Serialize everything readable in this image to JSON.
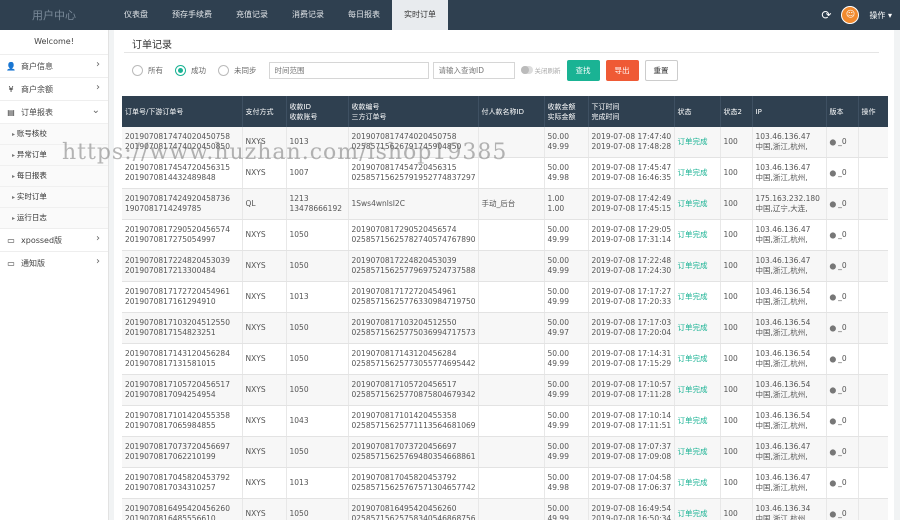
{
  "app": {
    "brand": "用户中心"
  },
  "nav": {
    "tabs": [
      {
        "label": "仪表盘"
      },
      {
        "label": "预存手续费"
      },
      {
        "label": "充值记录"
      },
      {
        "label": "消费记录"
      },
      {
        "label": "每日报表"
      },
      {
        "label": "实时订单"
      }
    ],
    "active_index": 5
  },
  "user": {
    "op_label": "操作 ▾"
  },
  "sidebar": {
    "welcome": "Welcome!",
    "items": [
      {
        "label": "商户信息",
        "icon": "user-icon"
      },
      {
        "label": "商户余额",
        "icon": "yen-icon"
      },
      {
        "label": "订单报表",
        "icon": "doc-icon"
      },
      {
        "label": "xpossed版",
        "icon": "monitor-icon"
      },
      {
        "label": "通知版",
        "icon": "monitor-icon"
      }
    ],
    "sub_items": [
      {
        "label": "账号核校"
      },
      {
        "label": "异常订单"
      },
      {
        "label": "每日报表"
      },
      {
        "label": "实时订单"
      },
      {
        "label": "运行日志"
      }
    ]
  },
  "panel": {
    "title": "订单记录",
    "radios": [
      {
        "label": "所有"
      },
      {
        "label": "成功"
      },
      {
        "label": "未同步"
      }
    ],
    "radio_selected": 1,
    "time_placeholder": "时间范围",
    "query_placeholder": "请输入查询ID",
    "toggle_label": "关闭刷新",
    "btn_find": "查找",
    "btn_export": "导出",
    "btn_reset": "重置"
  },
  "table": {
    "headers": [
      [
        "订单号/下游订单号"
      ],
      [
        "支付方式"
      ],
      [
        "收款ID",
        "收款账号"
      ],
      [
        "收款编号",
        "三方订单号"
      ],
      [
        "付人款名称ID"
      ],
      [
        "收款金额",
        "实际金额"
      ],
      [
        "下订时间",
        "完成时间"
      ],
      [
        "状态"
      ],
      [
        "状态2"
      ],
      [
        "IP"
      ],
      [
        "版本"
      ],
      [
        "操作"
      ]
    ],
    "rows": [
      {
        "order": "2019070817474020450758",
        "down": "2019070817474020450850",
        "pay": "NXYS",
        "rid": "1013",
        "racct": "",
        "rno": "2019070817474020450758",
        "tno": "02585715626791745904850",
        "payer": "",
        "amt": "50.00",
        "real": "49.99",
        "t1": "2019-07-08 17:47:40",
        "t2": "2019-07-08 17:48:28",
        "status": "订单完成",
        "s2": "100",
        "ip": "103.46.136.47",
        "loc": "中国,浙江,杭州,",
        "ver": "_0"
      },
      {
        "order": "2019070817454720456315",
        "down": "2019070814432489848",
        "pay": "NXYS",
        "rid": "1007",
        "racct": "",
        "rno": "2019070817454720456315",
        "tno": "02585715625791952774837297",
        "payer": "",
        "amt": "50.00",
        "real": "49.98",
        "t1": "2019-07-08 17:45:47",
        "t2": "2019-07-08 16:46:35",
        "status": "订单完成",
        "s2": "100",
        "ip": "103.46.136.47",
        "loc": "中国,浙江,杭州,",
        "ver": "_0"
      },
      {
        "order": "2019070817424920458736",
        "down": "1907081714249785",
        "pay": "QL",
        "rid": "1213",
        "racct": "13478666192",
        "rno": "1Sws4wnlsI2C",
        "tno": "",
        "payer": "手动_后台",
        "amt": "1.00",
        "real": "1.00",
        "t1": "2019-07-08 17:42:49",
        "t2": "2019-07-08 17:45:15",
        "status": "订单完成",
        "s2": "100",
        "ip": "175.163.232.180",
        "loc": "中国,辽宁,大连,",
        "ver": "_0"
      },
      {
        "order": "2019070817290520456574",
        "down": "2019070817275054997",
        "pay": "NXYS",
        "rid": "1050",
        "racct": "",
        "rno": "2019070817290520456574",
        "tno": "02585715625782740574767890",
        "payer": "",
        "amt": "50.00",
        "real": "49.99",
        "t1": "2019-07-08 17:29:05",
        "t2": "2019-07-08 17:31:14",
        "status": "订单完成",
        "s2": "100",
        "ip": "103.46.136.47",
        "loc": "中国,浙江,杭州,",
        "ver": "_0"
      },
      {
        "order": "2019070817224820453039",
        "down": "2019070817213300484",
        "pay": "NXYS",
        "rid": "1050",
        "racct": "",
        "rno": "2019070817224820453039",
        "tno": "02585715625779697524737588",
        "payer": "",
        "amt": "50.00",
        "real": "49.99",
        "t1": "2019-07-08 17:22:48",
        "t2": "2019-07-08 17:24:30",
        "status": "订单完成",
        "s2": "100",
        "ip": "103.46.136.47",
        "loc": "中国,浙江,杭州,",
        "ver": "_0"
      },
      {
        "order": "2019070817172720454961",
        "down": "2019070817161294910",
        "pay": "NXYS",
        "rid": "1013",
        "racct": "",
        "rno": "2019070817172720454961",
        "tno": "02585715625776330984719750",
        "payer": "",
        "amt": "50.00",
        "real": "49.99",
        "t1": "2019-07-08 17:17:27",
        "t2": "2019-07-08 17:20:33",
        "status": "订单完成",
        "s2": "100",
        "ip": "103.46.136.54",
        "loc": "中国,浙江,杭州,",
        "ver": "_0"
      },
      {
        "order": "2019070817103204512550",
        "down": "2019070817154823251",
        "pay": "NXYS",
        "rid": "1050",
        "racct": "",
        "rno": "2019070817103204512550",
        "tno": "02585715625775036994717573",
        "payer": "",
        "amt": "50.00",
        "real": "49.97",
        "t1": "2019-07-08 17:17:03",
        "t2": "2019-07-08 17:20:04",
        "status": "订单完成",
        "s2": "100",
        "ip": "103.46.136.54",
        "loc": "中国,浙江,杭州,",
        "ver": "_0"
      },
      {
        "order": "2019070817143120456284",
        "down": "2019070817131581015",
        "pay": "NXYS",
        "rid": "1050",
        "racct": "",
        "rno": "2019070817143120456284",
        "tno": "02585715625773055774695442",
        "payer": "",
        "amt": "50.00",
        "real": "49.99",
        "t1": "2019-07-08 17:14:31",
        "t2": "2019-07-08 17:15:29",
        "status": "订单完成",
        "s2": "100",
        "ip": "103.46.136.54",
        "loc": "中国,浙江,杭州,",
        "ver": "_0"
      },
      {
        "order": "2019070817105720456517",
        "down": "2019070817094254954",
        "pay": "NXYS",
        "rid": "1050",
        "racct": "",
        "rno": "2019070817105720456517",
        "tno": "02585715625770875804679342",
        "payer": "",
        "amt": "50.00",
        "real": "49.99",
        "t1": "2019-07-08 17:10:57",
        "t2": "2019-07-08 17:11:28",
        "status": "订单完成",
        "s2": "100",
        "ip": "103.46.136.54",
        "loc": "中国,浙江,杭州,",
        "ver": "_0"
      },
      {
        "order": "2019070817101420455358",
        "down": "2019070817065984855",
        "pay": "NXYS",
        "rid": "1043",
        "racct": "",
        "rno": "2019070817101420455358",
        "tno": "02585715625771113564681069",
        "payer": "",
        "amt": "50.00",
        "real": "49.99",
        "t1": "2019-07-08 17:10:14",
        "t2": "2019-07-08 17:11:51",
        "status": "订单完成",
        "s2": "100",
        "ip": "103.46.136.54",
        "loc": "中国,浙江,杭州,",
        "ver": "_0"
      },
      {
        "order": "2019070817073720456697",
        "down": "2019070817062210199",
        "pay": "NXYS",
        "rid": "1050",
        "racct": "",
        "rno": "2019070817073720456697",
        "tno": "02585715625769480354668861",
        "payer": "",
        "amt": "50.00",
        "real": "49.99",
        "t1": "2019-07-08 17:07:37",
        "t2": "2019-07-08 17:09:08",
        "status": "订单完成",
        "s2": "100",
        "ip": "103.46.136.47",
        "loc": "中国,浙江,杭州,",
        "ver": "_0"
      },
      {
        "order": "2019070817045820453792",
        "down": "2019070817034310257",
        "pay": "NXYS",
        "rid": "1013",
        "racct": "",
        "rno": "2019070817045820453792",
        "tno": "02585715625767571304657742",
        "payer": "",
        "amt": "50.00",
        "real": "49.98",
        "t1": "2019-07-08 17:04:58",
        "t2": "2019-07-08 17:06:37",
        "status": "订单完成",
        "s2": "100",
        "ip": "103.46.136.47",
        "loc": "中国,浙江,杭州,",
        "ver": "_0"
      },
      {
        "order": "2019070816495420456260",
        "down": "2019070816485556610",
        "pay": "NXYS",
        "rid": "1050",
        "racct": "",
        "rno": "2019070816495420456260",
        "tno": "02585715625758340546868756",
        "payer": "",
        "amt": "50.00",
        "real": "49.99",
        "t1": "2019-07-08 16:49:54",
        "t2": "2019-07-08 16:50:34",
        "status": "订单完成",
        "s2": "100",
        "ip": "103.46.136.34",
        "loc": "中国,浙江,杭州,",
        "ver": "_0"
      }
    ]
  },
  "watermark": "https://www.huzhan.com/ishop19385"
}
